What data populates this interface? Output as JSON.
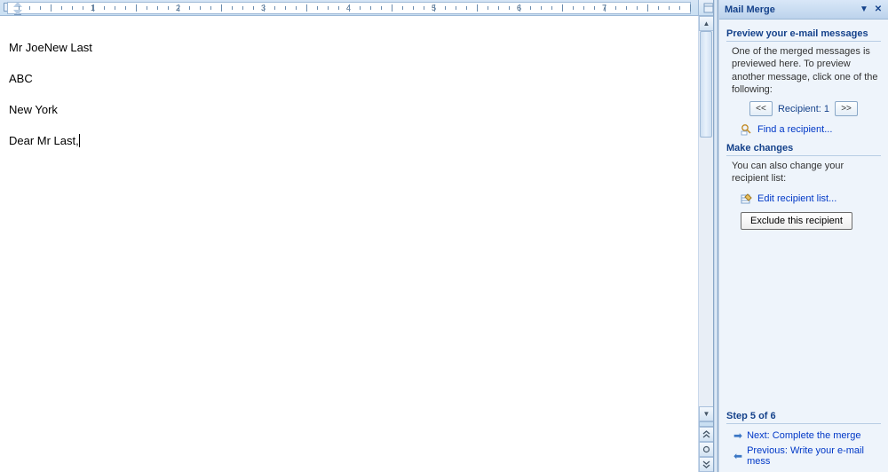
{
  "document": {
    "line1": "Mr JoeNew Last",
    "line2": "ABC",
    "line3": "New York",
    "line4": "Dear Mr Last,"
  },
  "ruler": {
    "numbers": [
      "1",
      "2",
      "3",
      "4",
      "5",
      "6",
      "7"
    ]
  },
  "taskpane": {
    "title": "Mail Merge",
    "section_preview": "Preview your e-mail messages",
    "preview_text": "One of the merged messages is previewed here. To preview another message, click one of the following:",
    "prev_btn": "<<",
    "recipient_label": "Recipient: 1",
    "next_btn": ">>",
    "find_recipient": "Find a recipient...",
    "section_changes": "Make changes",
    "changes_text": "You can also change your recipient list:",
    "edit_list": "Edit recipient list...",
    "exclude_btn": "Exclude this recipient",
    "step_label": "Step 5 of 6",
    "next_step": "Next: Complete the merge",
    "prev_step": "Previous: Write your e-mail mess"
  }
}
